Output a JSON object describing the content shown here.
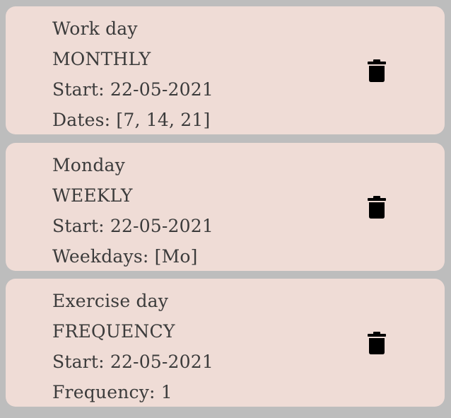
{
  "items": [
    {
      "name": "Work day",
      "type": "MONTHLY",
      "start": "Start: 22-05-2021",
      "detail": "Dates: [7, 14, 21]",
      "delete_icon": "trash-icon"
    },
    {
      "name": "Monday",
      "type": "WEEKLY",
      "start": "Start: 22-05-2021",
      "detail": "Weekdays: [Mo]",
      "delete_icon": "trash-icon"
    },
    {
      "name": "Exercise day",
      "type": "FREQUENCY",
      "start": "Start: 22-05-2021",
      "detail": "Frequency: 1",
      "delete_icon": "trash-icon"
    }
  ],
  "colors": {
    "background": "#bdbdbd",
    "card": "#efdcd6",
    "text": "#3b3b3b",
    "icon": "#000000"
  }
}
